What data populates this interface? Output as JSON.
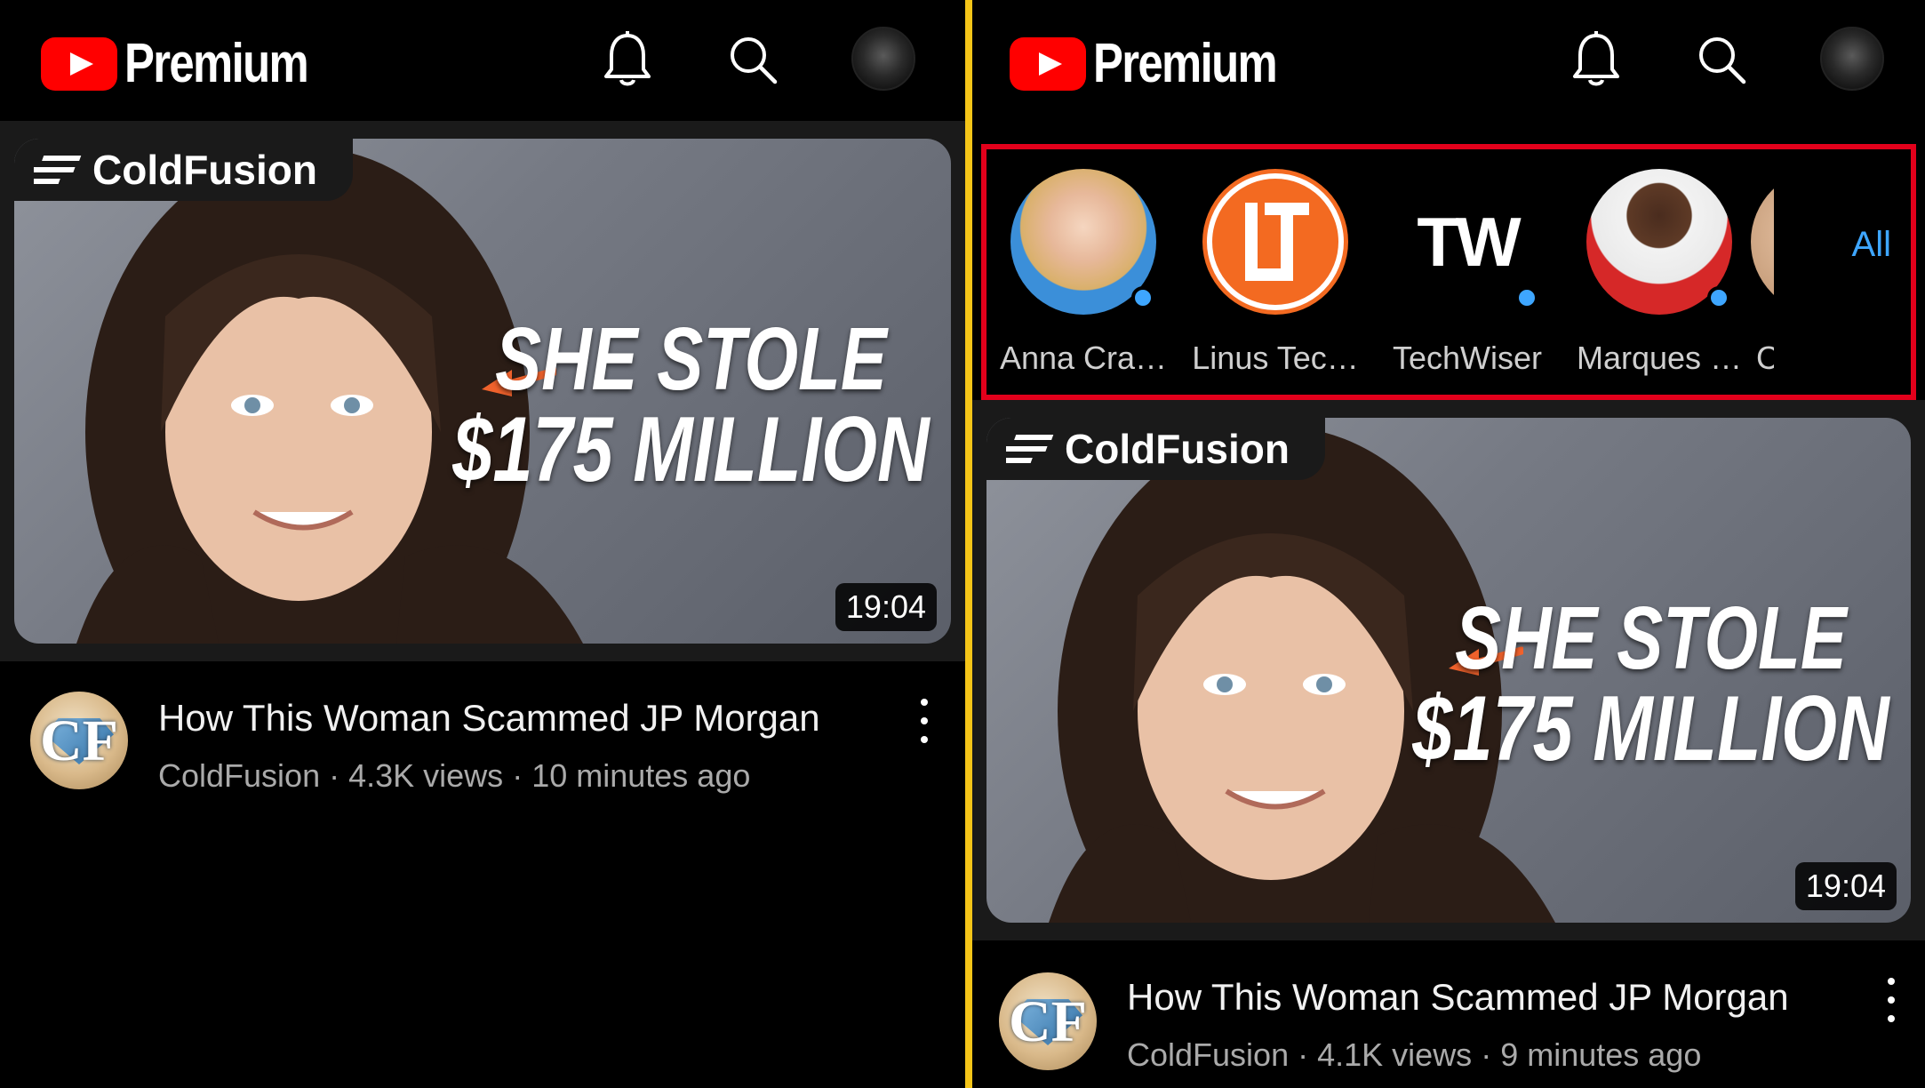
{
  "header": {
    "brand": "Premium"
  },
  "left_panel": {
    "video": {
      "channel_tag": "ColdFusion",
      "thumb_line1": "SHE STOLE",
      "thumb_line2": "$175 MILLION",
      "duration": "19:04",
      "title": "How This Woman Scammed JP Morgan",
      "channel": "ColdFusion",
      "views": "4.3K views",
      "age": "10 minutes ago",
      "avatar_text": "CF"
    }
  },
  "right_panel": {
    "subscriptions": [
      {
        "name": "Anna Cra…",
        "avatar": "woman-portrait",
        "new_content": true
      },
      {
        "name": "Linus Tec…",
        "avatar": "ltt-logo",
        "new_content": false
      },
      {
        "name": "TechWiser",
        "avatar": "tw-logo",
        "avatar_text": "TW",
        "new_content": true
      },
      {
        "name": "Marques …",
        "avatar": "man-portrait",
        "new_content": true
      },
      {
        "name": "C",
        "avatar": "partial-portrait",
        "new_content": false
      }
    ],
    "all_label": "All",
    "video": {
      "channel_tag": "ColdFusion",
      "thumb_line1": "SHE STOLE",
      "thumb_line2": "$175 MILLION",
      "duration": "19:04",
      "title": "How This Woman Scammed JP Morgan",
      "channel": "ColdFusion",
      "views": "4.1K views",
      "age": "9 minutes ago",
      "avatar_text": "CF"
    }
  },
  "colors": {
    "brand_red": "#ff0000",
    "highlight_border": "#e3001b",
    "divider": "#f5c518",
    "accent_blue": "#3ea6ff"
  }
}
